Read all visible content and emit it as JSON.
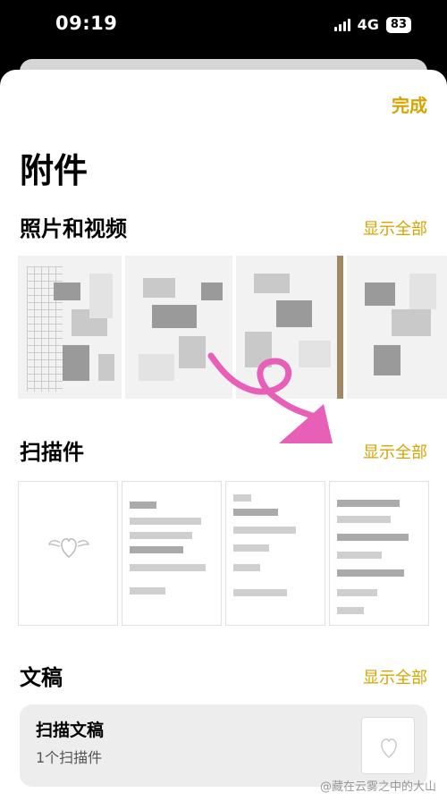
{
  "status_bar": {
    "time": "09:19",
    "network": "4G",
    "battery": "83"
  },
  "sheet": {
    "done_label": "完成",
    "title": "附件"
  },
  "sections": {
    "photos": {
      "title": "照片和视频",
      "show_all": "显示全部"
    },
    "scans": {
      "title": "扫描件",
      "show_all": "显示全部"
    },
    "documents": {
      "title": "文稿",
      "show_all": "显示全部"
    }
  },
  "document_card": {
    "title": "扫描文稿",
    "subtitle": "1个扫描件"
  },
  "watermark": "@藏在云雾之中的大山",
  "colors": {
    "accent": "#d6a400",
    "annotation_arrow": "#e85fb8"
  }
}
